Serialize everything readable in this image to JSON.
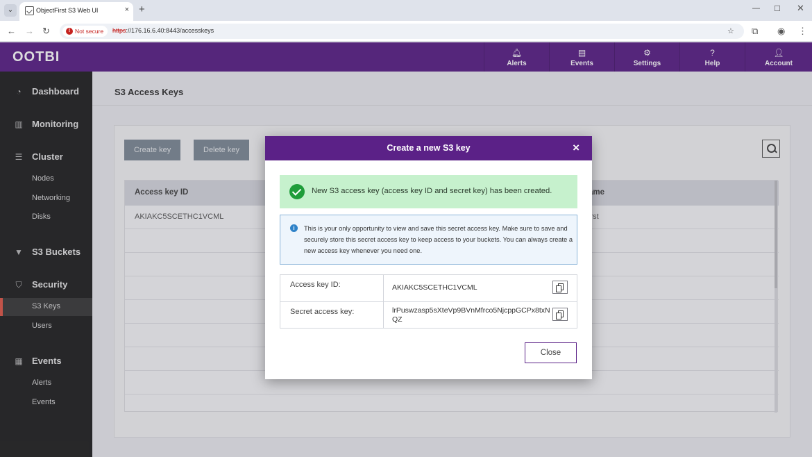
{
  "browser": {
    "tab_title": "ObjectFirst S3 Web UI",
    "tab_close": "×",
    "new_tab": "+",
    "security_label": "Not secure",
    "url_scheme": "https",
    "url_rest": "://176.16.6.40:8443/accesskeys",
    "icons": [
      "back-icon",
      "forward-icon",
      "reload-icon",
      "star-icon",
      "extensions-icon",
      "profile-icon",
      "menu-icon"
    ]
  },
  "header": {
    "logo": "OOTBI",
    "nav": [
      {
        "label": "Alerts",
        "icon": "bell-icon"
      },
      {
        "label": "Events",
        "icon": "list-icon"
      },
      {
        "label": "Settings",
        "icon": "gear-icon"
      },
      {
        "label": "Help",
        "icon": "help-icon"
      },
      {
        "label": "Account",
        "icon": "user-icon"
      }
    ],
    "color": "#5b2187"
  },
  "sidebar": {
    "dashboard": "Dashboard",
    "monitoring": "Monitoring",
    "cluster": "Cluster",
    "nodes": "Nodes",
    "networking": "Networking",
    "disks": "Disks",
    "s3_buckets": "S3 Buckets",
    "security": "Security",
    "s3_keys": "S3 Keys",
    "users": "Users",
    "events": "Events",
    "alerts_item": "Alerts",
    "events_item": "Events",
    "active_item": "S3 Keys",
    "accent_color": "#e0584a"
  },
  "main": {
    "page_title": "S3 Access Keys",
    "create_key": "Create key",
    "delete_key": "Delete key",
    "table": {
      "col_access_key_id": "Access key ID",
      "col_name_partial": "ame",
      "rows": [
        {
          "access_key_id": "AKIAKC5SCETHC1VCML",
          "name_partial": "irst"
        }
      ]
    }
  },
  "modal": {
    "title": "Create a new S3 key",
    "close_icon": "×",
    "success_text": "New S3 access key (access key ID and secret key) has been created.",
    "info_text": "This is your only opportunity to view and save this secret access key. Make sure to save and securely store this secret access key to keep access to your buckets. You can always create a new access key whenever you need one.",
    "access_key_label": "Access key ID:",
    "access_key_value": "AKIAKC5SCETHC1VCML",
    "secret_key_label": "Secret access key:",
    "secret_key_value": "lrPuswzasp5sXteVp9BVnMfrco5NjcppGCPx8txNQZ",
    "close_button": "Close",
    "success_color": "#1f9d3a",
    "info_color": "#2e82c8"
  }
}
